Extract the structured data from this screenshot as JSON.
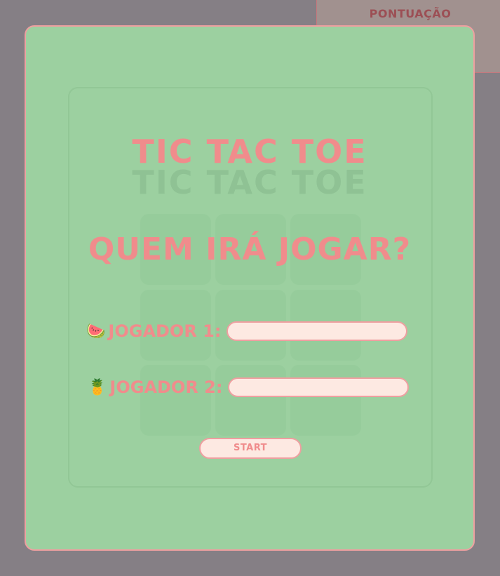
{
  "scoreboard": {
    "title": "PONTUAÇÃO",
    "icons": [
      "watermelon-icon",
      "pineapple-icon"
    ],
    "icon_glyphs": [
      "🍉",
      "🍍"
    ]
  },
  "game": {
    "title": "TIC TAC TOE",
    "title_shadow": "TIC TAC TOE"
  },
  "modal": {
    "question": "QUEM IRÁ JOGAR?",
    "players": [
      {
        "emoji": "🍉",
        "icon": "watermelon-icon",
        "label": "JOGADOR 1:",
        "value": "",
        "placeholder": ""
      },
      {
        "emoji": "🍍",
        "icon": "pineapple-icon",
        "label": "JOGADOR 2:",
        "value": "",
        "placeholder": ""
      }
    ],
    "start_label": "START"
  },
  "colors": {
    "backdrop": "#857f85",
    "modal_bg": "#9cd0a0",
    "accent": "#f08c8c",
    "input_bg": "#fde9e2"
  }
}
